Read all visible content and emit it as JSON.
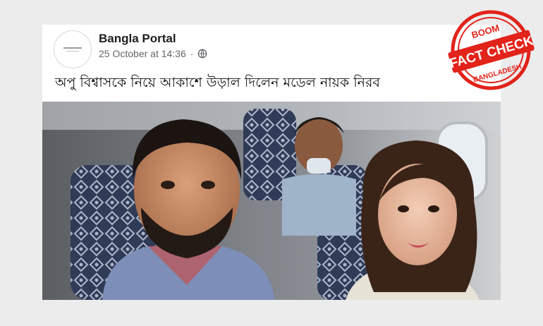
{
  "post": {
    "page_name": "Bangla Portal",
    "timestamp": "25 October at 14:36",
    "separator": "·",
    "text": "অপু বিশ্বাসকে নিয়ে আকাশে উড়াল দিলেন মডেল নায়ক নিরব",
    "privacy_icon": "globe-icon"
  },
  "stamp": {
    "top": "BOOM",
    "middle": "FACT CHECK",
    "bottom": "BANGLADESH",
    "color": "#e2231a"
  }
}
